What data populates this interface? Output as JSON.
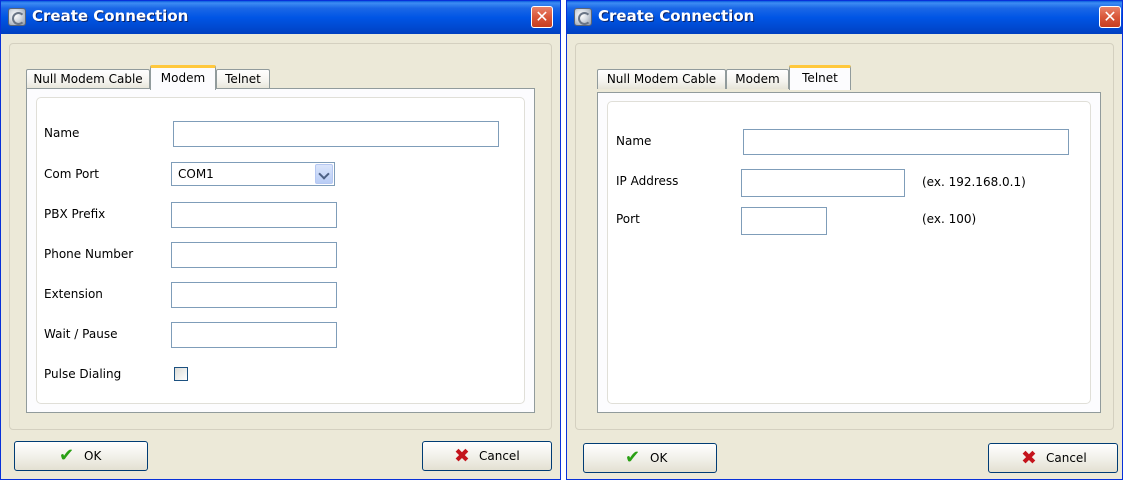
{
  "left_dialog": {
    "title": "Create Connection",
    "close": "✕",
    "tabs": [
      {
        "label": "Null Modem Cable",
        "active": false
      },
      {
        "label": "Modem",
        "active": true
      },
      {
        "label": "Telnet",
        "active": false
      }
    ],
    "fields": {
      "name_label": "Name",
      "name_value": "",
      "com_port_label": "Com Port",
      "com_port_value": "COM1",
      "pbx_prefix_label": "PBX Prefix",
      "pbx_prefix_value": "",
      "phone_number_label": "Phone Number",
      "phone_number_value": "",
      "extension_label": "Extension",
      "extension_value": "",
      "wait_pause_label": "Wait / Pause",
      "wait_pause_value": "",
      "pulse_dialing_label": "Pulse Dialing",
      "pulse_dialing_checked": false
    },
    "ok_label": "OK",
    "cancel_label": "Cancel"
  },
  "right_dialog": {
    "title": "Create Connection",
    "close": "✕",
    "tabs": [
      {
        "label": "Null Modem Cable",
        "active": false
      },
      {
        "label": "Modem",
        "active": false
      },
      {
        "label": "Telnet",
        "active": true
      }
    ],
    "fields": {
      "name_label": "Name",
      "name_value": "",
      "ip_address_label": "IP Address",
      "ip_address_value": "",
      "ip_address_hint": "(ex. 192.168.0.1)",
      "port_label": "Port",
      "port_value": "",
      "port_hint": "(ex. 100)"
    },
    "ok_label": "OK",
    "cancel_label": "Cancel"
  },
  "icons": {
    "ok": "✔",
    "cancel": "✖"
  },
  "colors": {
    "titlebar": "#0055e5",
    "window_bg": "#ece9d8",
    "active_tab_highlight": "#ffc83c",
    "close_button": "#d9573a",
    "ok_icon": "#2aa014",
    "cancel_icon": "#c4141c"
  }
}
